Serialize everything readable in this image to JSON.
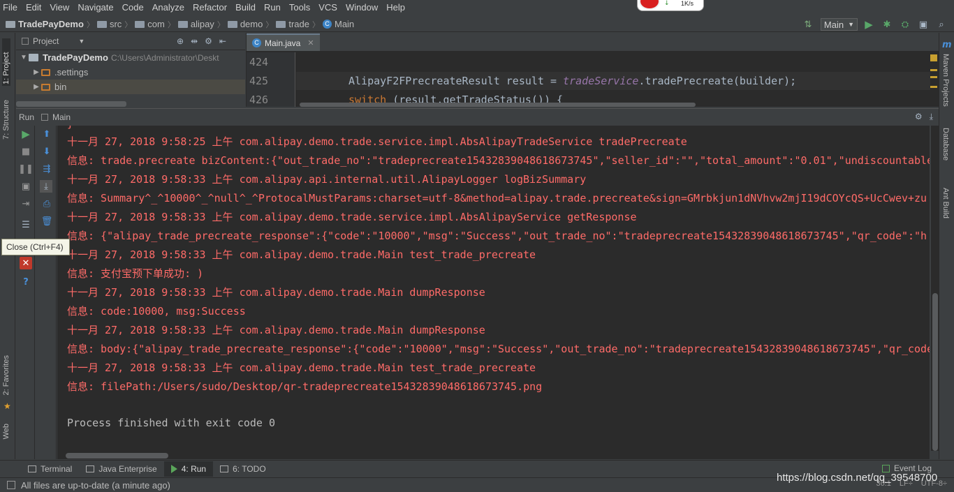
{
  "menu": [
    "File",
    "Edit",
    "View",
    "Navigate",
    "Code",
    "Analyze",
    "Refactor",
    "Build",
    "Run",
    "Tools",
    "VCS",
    "Window",
    "Help"
  ],
  "net_speed": "1K/s",
  "breadcrumb": [
    {
      "label": "TradePayDemo",
      "icon": "project-folder-icon"
    },
    {
      "label": "src",
      "icon": "folder-icon"
    },
    {
      "label": "com",
      "icon": "folder-icon"
    },
    {
      "label": "alipay",
      "icon": "folder-icon"
    },
    {
      "label": "demo",
      "icon": "folder-icon"
    },
    {
      "label": "trade",
      "icon": "folder-icon"
    },
    {
      "label": "Main",
      "icon": "class-icon"
    }
  ],
  "run_config": "Main",
  "left_tabs": {
    "project": "1: Project",
    "structure": "7: Structure",
    "favorites": "2: Favorites",
    "web": "Web"
  },
  "right_tabs": {
    "maven": "Maven Projects",
    "database": "Database",
    "ant": "Ant Build"
  },
  "project_panel": {
    "title": "Project",
    "root": {
      "label": "TradePayDemo",
      "path": "C:\\Users\\Administrator\\Deskt"
    },
    "items": [
      ".settings",
      "bin"
    ]
  },
  "editor": {
    "tab": "Main.java",
    "lines": [
      {
        "num": "424",
        "code": ""
      },
      {
        "num": "425",
        "code": "AlipayF2FPrecreateResult result = tradeService.tradePrecreate(builder);"
      },
      {
        "num": "426",
        "code": "switch (result.getTradeStatus()) {"
      }
    ],
    "line425_prefix": "AlipayF2FPrecreateResult result = ",
    "line425_field": "tradeService",
    "line425_suffix": ".tradePrecreate(builder);",
    "line426_kw": "switch",
    "line426_rest": " (result.getTradeStatus()) {"
  },
  "run_panel": {
    "title": "Run",
    "config": "Main"
  },
  "tooltip": "Close (Ctrl+F4)",
  "console": [
    "十一月 27, 2018 9:58:25 上午 com.alipay.demo.trade.service.impl.AbsAlipayTradeService tradePrecreate",
    "信息: trade.precreate bizContent:{\"out_trade_no\":\"tradeprecreate15432839048618673745\",\"seller_id\":\"\",\"total_amount\":\"0.01\",\"undiscountable",
    "十一月 27, 2018 9:58:33 上午 com.alipay.api.internal.util.AlipayLogger logBizSummary",
    "信息: Summary^_^10000^_^null^_^ProtocalMustParams:charset=utf-8&method=alipay.trade.precreate&sign=GMrbkjun1dNVhvw2mjI19dCOYcQS+UcCwev+zu",
    "十一月 27, 2018 9:58:33 上午 com.alipay.demo.trade.service.impl.AbsAlipayService getResponse",
    "信息: {\"alipay_trade_precreate_response\":{\"code\":\"10000\",\"msg\":\"Success\",\"out_trade_no\":\"tradeprecreate15432839048618673745\",\"qr_code\":\"h",
    "十一月 27, 2018 9:58:33 上午 com.alipay.demo.trade.Main test_trade_precreate",
    "信息: 支付宝预下单成功: )",
    "十一月 27, 2018 9:58:33 上午 com.alipay.demo.trade.Main dumpResponse",
    "信息: code:10000, msg:Success",
    "十一月 27, 2018 9:58:33 上午 com.alipay.demo.trade.Main dumpResponse",
    "信息: body:{\"alipay_trade_precreate_response\":{\"code\":\"10000\",\"msg\":\"Success\",\"out_trade_no\":\"tradeprecreate15432839048618673745\",\"qr_code",
    "十一月 27, 2018 9:58:33 上午 com.alipay.demo.trade.Main test_trade_precreate",
    "信息: filePath:/Users/sudo/Desktop/qr-tradeprecreate15432839048618673745.png",
    "",
    "Process finished with exit code 0"
  ],
  "bottom_tabs": [
    {
      "label": "Terminal",
      "icon": "terminal-icon"
    },
    {
      "label": "Java Enterprise",
      "icon": "java-enterprise-icon"
    },
    {
      "label": "4: Run",
      "icon": "run-icon"
    },
    {
      "label": "6: TODO",
      "icon": "todo-icon"
    }
  ],
  "event_log": "Event Log",
  "status": {
    "message": "All files are up-to-date (a minute ago)",
    "position": "36:1",
    "line_sep": "LF÷",
    "encoding": "UTF-8÷"
  },
  "watermark": "https://blog.csdn.net/qq_39548700",
  "colors": {
    "error_text": "#ff6b68",
    "normal_text": "#bbbbbb",
    "bg": "#2b2b2b",
    "chrome": "#3c3f41"
  }
}
